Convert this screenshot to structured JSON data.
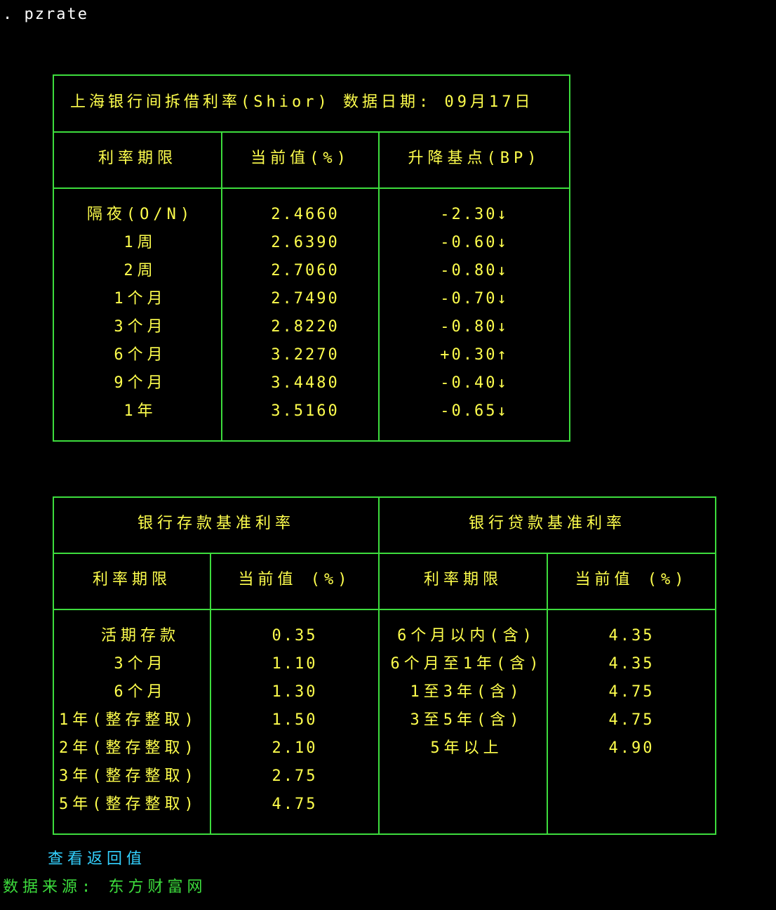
{
  "prompt": ". pzrate",
  "shibor": {
    "title": "上海银行间拆借利率(Shior) 数据日期: 09月17日",
    "headers": [
      "利率期限",
      "当前值(%)",
      "升降基点(BP)"
    ],
    "rows": [
      {
        "term": "隔夜(O/N)",
        "value": "2.4660",
        "change": "-2.30↓"
      },
      {
        "term": "1周",
        "value": "2.6390",
        "change": "-0.60↓"
      },
      {
        "term": "2周",
        "value": "2.7060",
        "change": "-0.80↓"
      },
      {
        "term": "1个月",
        "value": "2.7490",
        "change": "-0.70↓"
      },
      {
        "term": "3个月",
        "value": "2.8220",
        "change": "-0.80↓"
      },
      {
        "term": "6个月",
        "value": "3.2270",
        "change": "+0.30↑"
      },
      {
        "term": "9个月",
        "value": "3.4480",
        "change": "-0.40↓"
      },
      {
        "term": "1年",
        "value": "3.5160",
        "change": "-0.65↓"
      }
    ]
  },
  "bank": {
    "deposit_title": "银行存款基准利率",
    "loan_title": "银行贷款基准利率",
    "deposit_headers": [
      "利率期限",
      "当前值 (%)"
    ],
    "loan_headers": [
      "利率期限",
      "当前值 (%)"
    ],
    "deposit_rows": [
      {
        "term": "活期存款",
        "value": "0.35"
      },
      {
        "term": "3个月",
        "value": "1.10"
      },
      {
        "term": "6个月",
        "value": "1.30"
      },
      {
        "term": "1年(整存整取)",
        "value": "1.50"
      },
      {
        "term": "2年(整存整取)",
        "value": "2.10"
      },
      {
        "term": "3年(整存整取)",
        "value": "2.75"
      },
      {
        "term": "5年(整存整取)",
        "value": "4.75"
      }
    ],
    "loan_rows": [
      {
        "term": "6个月以内(含)",
        "value": "4.35"
      },
      {
        "term": "6个月至1年(含)",
        "value": "4.35"
      },
      {
        "term": "1至3年(含)",
        "value": "4.75"
      },
      {
        "term": "3至5年(含)",
        "value": "4.75"
      },
      {
        "term": "5年以上",
        "value": "4.90"
      }
    ]
  },
  "view_return_value": "查看返回值",
  "data_source": "数据来源: 东方财富网",
  "colors": {
    "background": "#000000",
    "text": "#ffff4d",
    "border": "#3ddc3d",
    "link": "#33d1ff",
    "prompt": "#ffffff"
  }
}
